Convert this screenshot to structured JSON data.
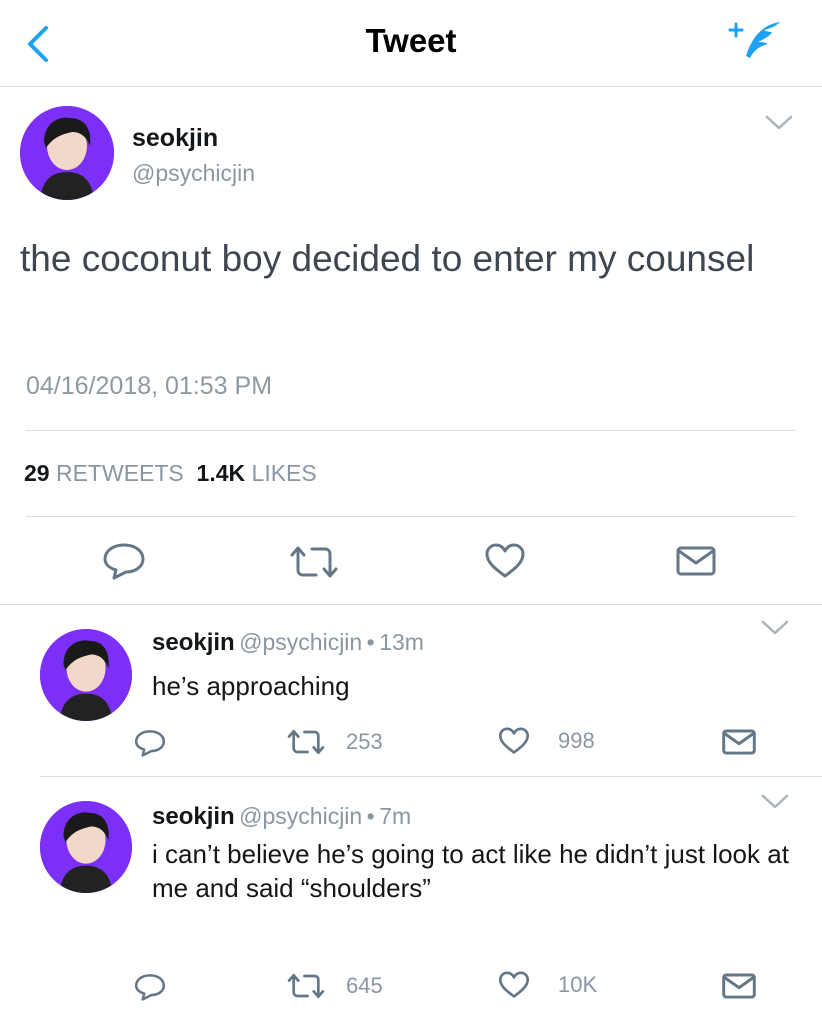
{
  "nav": {
    "title": "Tweet"
  },
  "tweet": {
    "name": "seokjin",
    "handle": "@psychicjin",
    "text": "the coconut boy decided to enter my counsel",
    "timestamp": "04/16/2018, 01:53 PM",
    "retweets": "29",
    "retweets_label": "RETWEETS",
    "likes": "1.4K",
    "likes_label": "LIKES"
  },
  "replies": [
    {
      "name": "seokjin",
      "handle": "@psychicjin",
      "sep": "•",
      "time": "13m",
      "text": "he’s approaching",
      "retweets": "253",
      "likes": "998"
    },
    {
      "name": "seokjin",
      "handle": "@psychicjin",
      "sep": "•",
      "time": "7m",
      "text": "i can’t believe he’s going to act like he didn’t just look at me and said “shoulders”",
      "retweets": "645",
      "likes": "10K"
    }
  ],
  "colors": {
    "accent": "#1da1f2",
    "icon_gray": "#657786",
    "avatar_bg": "#7b2ff7"
  }
}
